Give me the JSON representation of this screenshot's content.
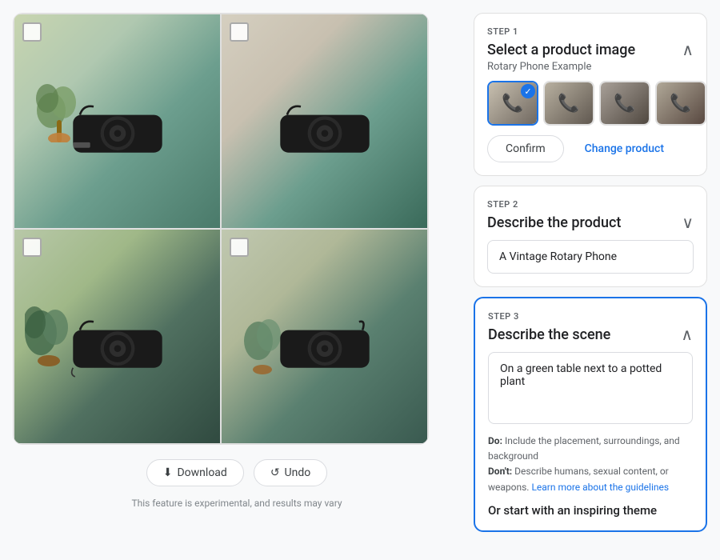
{
  "steps": {
    "step1": {
      "label": "STEP 1",
      "title": "Select a product image",
      "subtitle": "Rotary Phone Example",
      "confirm_btn": "Confirm",
      "change_btn": "Change product",
      "thumbnails": [
        {
          "id": 1,
          "selected": true,
          "alt": "Rotary phone front view"
        },
        {
          "id": 2,
          "selected": false,
          "alt": "Rotary phone side view"
        },
        {
          "id": 3,
          "selected": false,
          "alt": "Rotary phone top view"
        },
        {
          "id": 4,
          "selected": false,
          "alt": "Rotary phone angle view"
        }
      ]
    },
    "step2": {
      "label": "STEP 2",
      "title": "Describe the product",
      "input_value": "A Vintage Rotary Phone",
      "input_placeholder": "A Vintage Rotary Phone"
    },
    "step3": {
      "label": "STEP 3",
      "title": "Describe the scene",
      "textarea_value": "On a green table next to a potted plant",
      "textarea_placeholder": "On a green table next to a potted plant",
      "do_text": "Do: Include the placement, surroundings, and background",
      "dont_text": "Don't: Describe humans, sexual content, or weapons.",
      "guidelines_link": "Learn more about the guidelines",
      "theme_title": "Or start with an inspiring theme"
    }
  },
  "image_grid": {
    "cells": [
      {
        "id": 1,
        "label": "Top left phone"
      },
      {
        "id": 2,
        "label": "Top right phone"
      },
      {
        "id": 3,
        "label": "Bottom left phone"
      },
      {
        "id": 4,
        "label": "Bottom right phone"
      }
    ]
  },
  "bottom_bar": {
    "download_label": "Download",
    "undo_label": "Undo",
    "experimental_text": "This feature is experimental, and results may vary"
  }
}
